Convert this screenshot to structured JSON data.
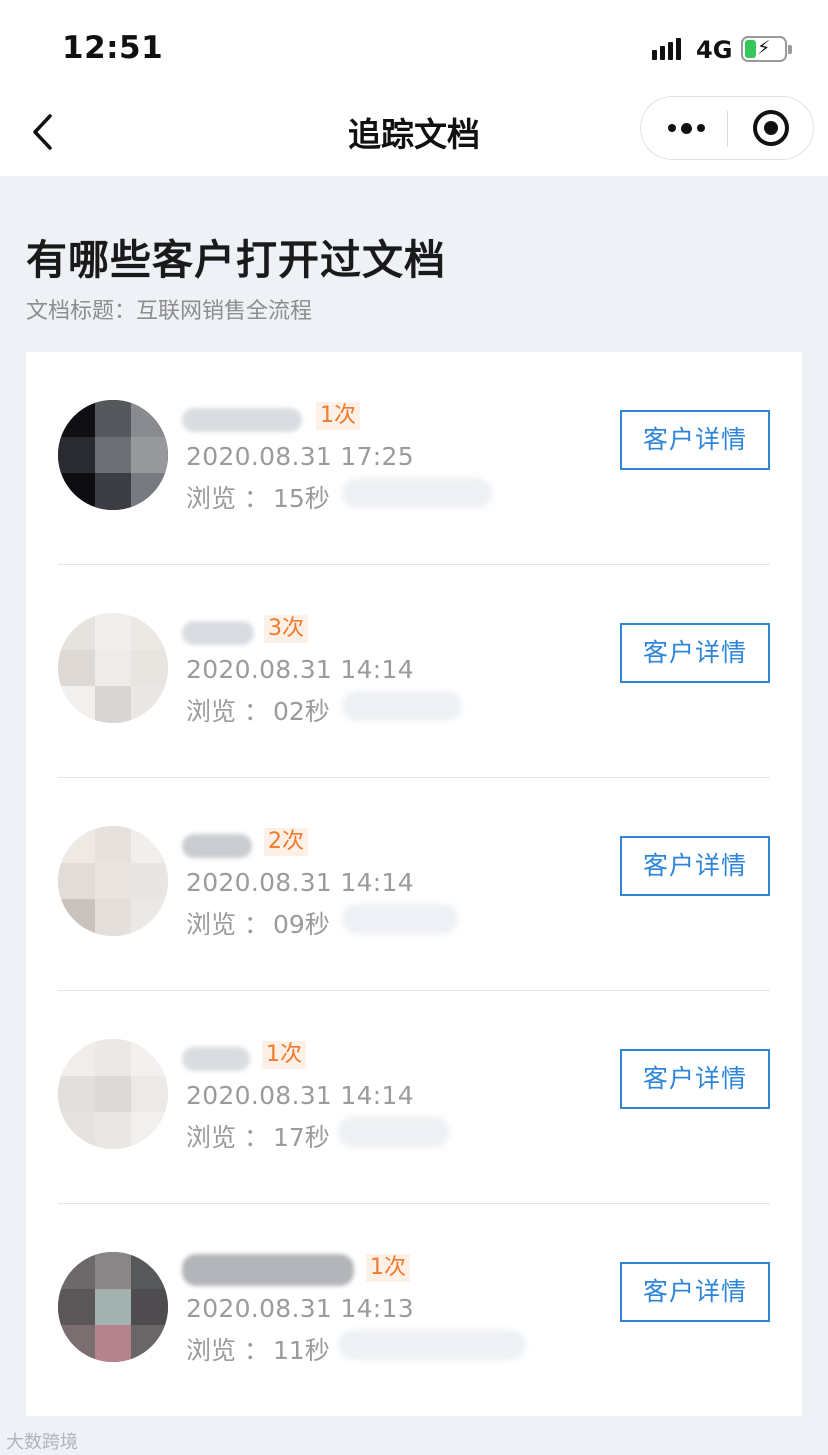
{
  "status_bar": {
    "time": "12:51",
    "network": "4G"
  },
  "nav": {
    "title": "追踪文档"
  },
  "page": {
    "heading": "有哪些客户打开过文档",
    "doc_title": "文档标题：互联网销售全流程"
  },
  "detail_label": "客户详情",
  "browse_label": "浏览",
  "browse_sep": "：",
  "customers": [
    {
      "count": "1次",
      "time": "2020.08.31 17:25",
      "duration": "15秒"
    },
    {
      "count": "3次",
      "time": "2020.08.31 14:14",
      "duration": "02秒"
    },
    {
      "count": "2次",
      "time": "2020.08.31 14:14",
      "duration": "09秒"
    },
    {
      "count": "1次",
      "time": "2020.08.31 14:14",
      "duration": "17秒"
    },
    {
      "count": "1次",
      "time": "2020.08.31 14:13",
      "duration": "11秒"
    }
  ],
  "watermark": "大数跨境",
  "colors": {
    "accent": "#2f86d8",
    "badge_text": "#f07a2e",
    "badge_bg": "#fdf0e6",
    "page_bg": "#eef1f5"
  }
}
